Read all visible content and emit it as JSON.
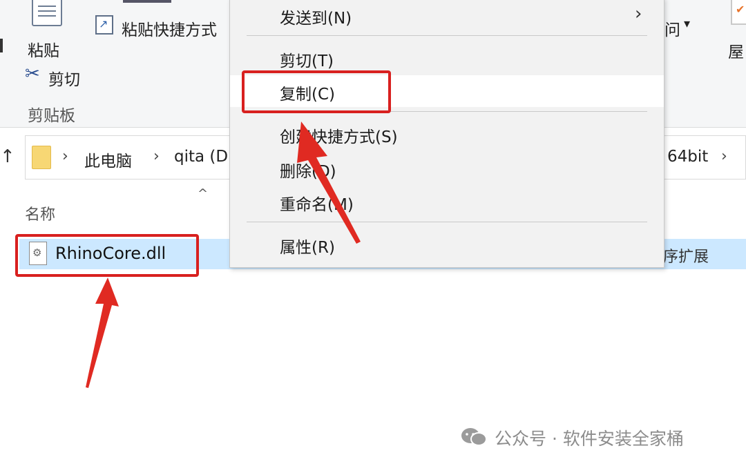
{
  "ribbon": {
    "paste_label": "粘贴",
    "paste_shortcut_label": "粘贴快捷方式",
    "cut_label": "剪切",
    "clipboard_group_label": "剪贴板",
    "access_label_partial": "问",
    "access_caret": "▾",
    "properties_label_partial": "屋"
  },
  "address_bar": {
    "up_arrow": "↑",
    "separator": "›",
    "segments": [
      "此电脑",
      "qita (D",
      "64bit"
    ]
  },
  "file_list": {
    "column_name": "名称",
    "sort_caret": "^",
    "files": [
      {
        "name": "RhinoCore.dll",
        "type_partial": "序扩展"
      }
    ]
  },
  "context_menu": {
    "submenu_arrow": "›",
    "items": [
      {
        "label": "发送到(N)"
      },
      {
        "label": "剪切(T)"
      },
      {
        "label": "复制(C)"
      },
      {
        "label": "创建快捷方式(S)"
      },
      {
        "label": "删除(D)"
      },
      {
        "label": "重命名(M)"
      },
      {
        "label": "属性(R)"
      }
    ]
  },
  "annotations": {
    "highlight_color": "#d8201f"
  },
  "watermark": {
    "text": "公众号 · 软件安装全家桶"
  }
}
